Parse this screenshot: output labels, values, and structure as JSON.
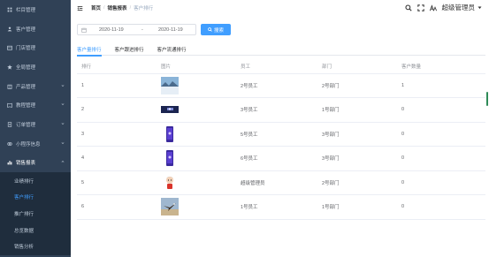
{
  "sidebar": {
    "items": [
      {
        "label": "栏目管理",
        "icon": "grid-icon",
        "arrow": false
      },
      {
        "label": "客户管理",
        "icon": "user-icon",
        "arrow": false
      },
      {
        "label": "门店管理",
        "icon": "store-icon",
        "arrow": false
      },
      {
        "label": "全局管理",
        "icon": "star-icon",
        "arrow": false
      },
      {
        "label": "产品管理",
        "icon": "box-icon",
        "arrow": true
      },
      {
        "label": "教程管理",
        "icon": "book-icon",
        "arrow": true
      },
      {
        "label": "订单管理",
        "icon": "order-icon",
        "arrow": true
      },
      {
        "label": "小程序信息",
        "icon": "miniapp-icon",
        "arrow": true
      }
    ],
    "open_group": {
      "label": "销售报表",
      "icon": "bar-chart-icon"
    },
    "sub_items": [
      "业绩排行",
      "客户排行",
      "推广排行",
      "总览数据",
      "销售分析"
    ],
    "active_sub_index": 1
  },
  "breadcrumb": {
    "home": "首页",
    "section": "销售报表",
    "current": "客户排行",
    "separator": "/"
  },
  "header": {
    "user": "超级管理员"
  },
  "filter": {
    "start_date": "2020-11-19",
    "range_separator": "-",
    "end_date": "2020-11-19",
    "search_label": "搜索"
  },
  "tabs": [
    {
      "label": "客户量排行",
      "active": true
    },
    {
      "label": "客户跟进排行",
      "active": false
    },
    {
      "label": "客户流通排行",
      "active": false
    }
  ],
  "table": {
    "headers": [
      "排行",
      "图片",
      "员工",
      "部门",
      "客户数量"
    ],
    "rows": [
      {
        "rank": "1",
        "image": "winter-landscape-photo",
        "staff": "2号员工",
        "dept": "2号部门",
        "count": "1"
      },
      {
        "rank": "2",
        "image": "night-skyline-photo",
        "staff": "3号员工",
        "dept": "1号部门",
        "count": "0"
      },
      {
        "rank": "3",
        "image": "purple-phone-photo",
        "staff": "5号员工",
        "dept": "3号部门",
        "count": "0"
      },
      {
        "rank": "4",
        "image": "purple-phone-photo",
        "staff": "6号员工",
        "dept": "3号部门",
        "count": "0"
      },
      {
        "rank": "5",
        "image": "cartoon-avatar-photo",
        "staff": "超级管理员",
        "dept": "2号部门",
        "count": "0"
      },
      {
        "rank": "6",
        "image": "eagle-flight-photo",
        "staff": "1号员工",
        "dept": "1号部门",
        "count": "0"
      }
    ]
  },
  "colors": {
    "sidebar_bg": "#304156",
    "submenu_bg": "#1f2d3d",
    "accent": "#409eff"
  }
}
